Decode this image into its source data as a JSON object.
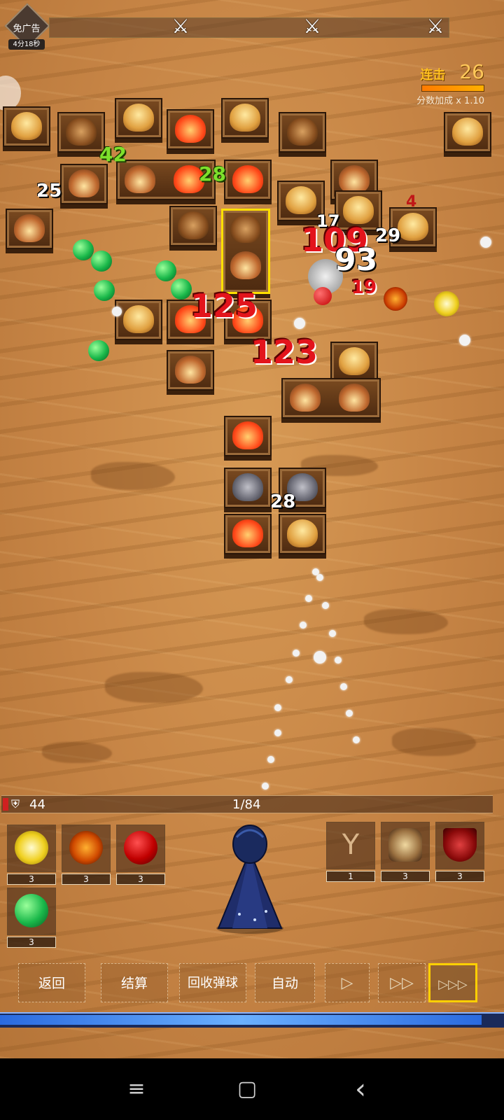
{
  "top": {
    "no_ads_label": "免广告",
    "timer": "4分18秒",
    "wave_markers": [
      "⚔",
      "⚔",
      "⚔"
    ]
  },
  "combo": {
    "label": "连击",
    "value": "26",
    "multiplier": "分数加成 x 1.10",
    "bar_fill": 0.9
  },
  "field": {
    "damage_numbers": [
      {
        "text": "42",
        "style": "green"
      },
      {
        "text": "28",
        "style": "green"
      },
      {
        "text": "25",
        "style": "white"
      },
      {
        "text": "17",
        "style": "white"
      },
      {
        "text": "109",
        "style": "red"
      },
      {
        "text": "93",
        "style": "white"
      },
      {
        "text": "29",
        "style": "white"
      },
      {
        "text": "125",
        "style": "red"
      },
      {
        "text": "123",
        "style": "red"
      },
      {
        "text": "19",
        "style": "red"
      },
      {
        "text": "28",
        "style": "white"
      },
      {
        "text": "4",
        "style": "red"
      }
    ]
  },
  "hud": {
    "shield_value": "44",
    "ball_count": "1/84",
    "hp_fill": 0.01,
    "ball_slots": [
      {
        "name": "light-orb",
        "level": "3",
        "color": "#f4e04a"
      },
      {
        "name": "lava-orb",
        "level": "3",
        "color": "#e8601a"
      },
      {
        "name": "blood-orb",
        "level": "3",
        "color": "#d01818"
      },
      {
        "name": "poison-orb",
        "level": "3",
        "color": "#2ad060"
      }
    ],
    "equip_slots": [
      {
        "name": "slingshot",
        "level": "1"
      },
      {
        "name": "armor",
        "level": "3"
      },
      {
        "name": "shield",
        "level": "3"
      }
    ]
  },
  "buttons": {
    "back": "返回",
    "settle": "结算",
    "recall": "回收弹球",
    "auto": "自动",
    "play": "▷",
    "fast": "▷▷",
    "fastest": "▷▷▷"
  },
  "progress": {
    "fill": 0.955
  },
  "navbar": {
    "menu": "≡",
    "home": "▢",
    "back": "‹"
  }
}
